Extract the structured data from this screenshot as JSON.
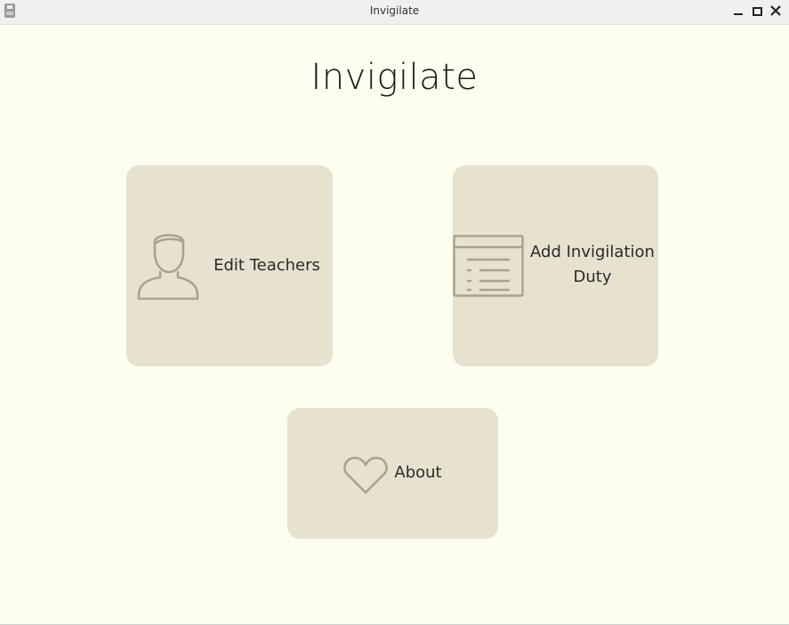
{
  "window": {
    "title": "Invigilate"
  },
  "app": {
    "heading": "Invigilate"
  },
  "cards": {
    "teachers": {
      "label": "Edit Teachers",
      "icon": "person-outline-icon"
    },
    "duty": {
      "label_line1": "Add Invigilation",
      "label_line2": "Duty",
      "icon": "list-document-icon"
    },
    "about": {
      "label": "About",
      "icon": "heart-outline-icon"
    }
  },
  "colors": {
    "background": "#fdfdf0",
    "card": "#e7e1cf",
    "icon_stroke": "#a8a290",
    "text": "#2a2a2a"
  }
}
